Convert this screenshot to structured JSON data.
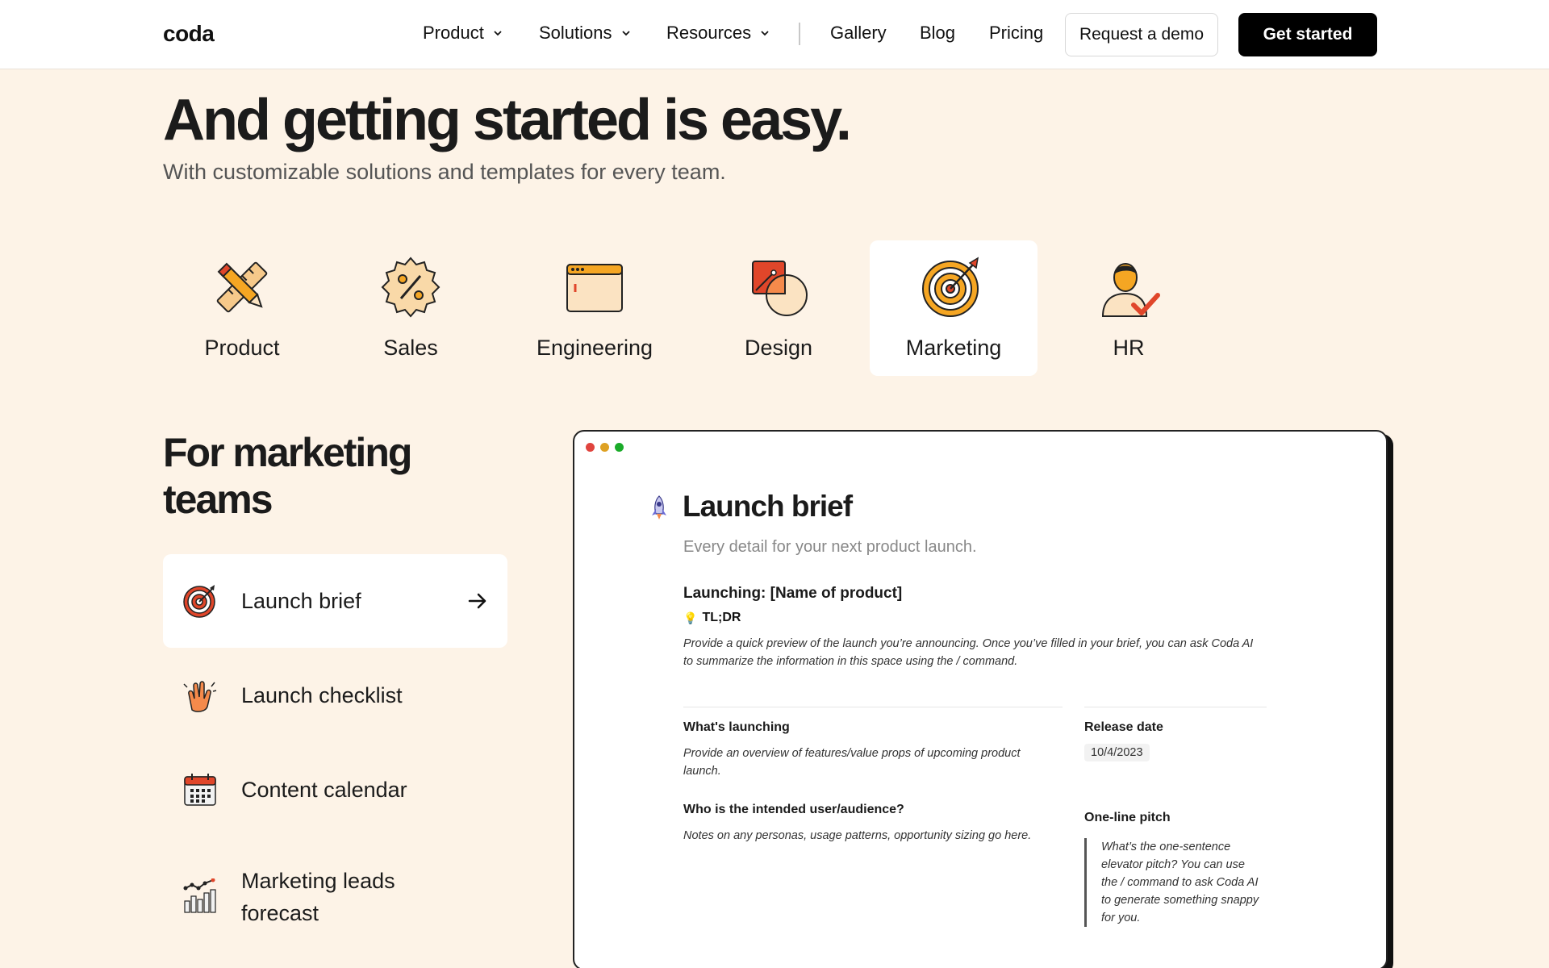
{
  "nav": {
    "logo": "coda",
    "links": [
      {
        "label": "Product",
        "dropdown": true
      },
      {
        "label": "Solutions",
        "dropdown": true
      },
      {
        "label": "Resources",
        "dropdown": true
      },
      {
        "label": "Gallery",
        "dropdown": false
      },
      {
        "label": "Blog",
        "dropdown": false
      },
      {
        "label": "Pricing",
        "dropdown": false
      }
    ],
    "demo_button": "Request a demo",
    "start_button": "Get started"
  },
  "hero": {
    "title": "And getting started is easy.",
    "subtitle": "With customizable solutions and templates for every team."
  },
  "teams": {
    "active": "Marketing",
    "items": [
      {
        "label": "Product",
        "icon": "pencil-ruler-icon"
      },
      {
        "label": "Sales",
        "icon": "percent-badge-icon"
      },
      {
        "label": "Engineering",
        "icon": "browser-window-icon"
      },
      {
        "label": "Design",
        "icon": "shapes-icon"
      },
      {
        "label": "Marketing",
        "icon": "target-icon"
      },
      {
        "label": "HR",
        "icon": "person-check-icon"
      }
    ]
  },
  "section": {
    "title": "For marketing teams",
    "templates": [
      {
        "label": "Launch brief",
        "icon": "target-icon",
        "active": true
      },
      {
        "label": "Launch checklist",
        "icon": "clapping-hands-icon",
        "active": false
      },
      {
        "label": "Content calendar",
        "icon": "calendar-icon",
        "active": false
      },
      {
        "label": "Marketing leads forecast",
        "icon": "bar-chart-icon",
        "active": false
      }
    ]
  },
  "preview": {
    "title": "Launch brief",
    "subtitle": "Every detail for your next product launch.",
    "launching_heading": "Launching: [Name of product]",
    "tldr_label": "TL;DR",
    "tldr_note": "Provide a quick preview of the launch you’re announcing. Once you’ve filled in your brief, you can ask Coda AI to summarize the information in this space using the / command.",
    "whats_launching_label": "What's launching",
    "whats_launching_note": "Provide an overview of features/value props of upcoming product launch.",
    "release_date_label": "Release date",
    "release_date_value": "10/4/2023",
    "audience_label": "Who is the intended user/audience?",
    "audience_note": "Notes on any personas, usage patterns, opportunity sizing go here.",
    "pitch_label": "One-line pitch",
    "pitch_note": "What’s the one-sentence elevator pitch? You can use the / command to ask Coda AI to generate something snappy for you.",
    "window_dot_colors": [
      "#e0443e",
      "#dea123",
      "#1aab29"
    ]
  },
  "colors": {
    "page_bg": "#fdf3e7",
    "accent_orange": "#f5a623",
    "accent_red": "#e0462a",
    "dark": "#111111"
  }
}
